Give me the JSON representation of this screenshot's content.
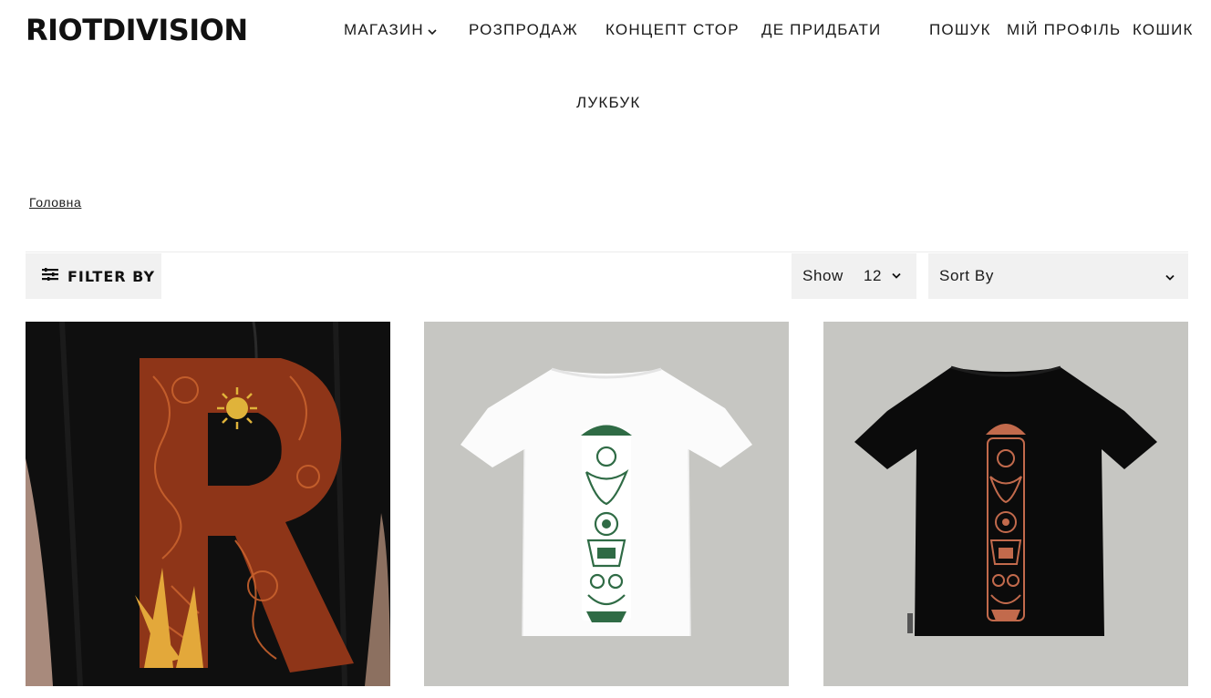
{
  "header": {
    "logo": "RIOTDIVISION",
    "nav": [
      {
        "label": "МАГАЗИН",
        "has_dropdown": true
      },
      {
        "label": "РОЗПРОДАЖ"
      },
      {
        "label": "КОНЦЕПТ СТОР"
      },
      {
        "label": "ДЕ ПРИДБАТИ"
      },
      {
        "label": "ЛУКБУК"
      }
    ],
    "utility": {
      "search": "ПОШУК",
      "profile": "МІЙ ПРОФІЛЬ",
      "cart": "КОШИК"
    }
  },
  "breadcrumb": {
    "home": "Головна"
  },
  "toolbar": {
    "filter_label": "FILTER BY",
    "show_label": "Show",
    "show_value": "12",
    "sort_label": "Sort By"
  },
  "products": [
    {
      "image": "black t-shirt with large orange ornamental R print, worn by model"
    },
    {
      "image": "white t-shirt with green vertical ornamental print on back"
    },
    {
      "image": "black t-shirt with orange vertical ornamental print on back"
    }
  ],
  "colors": {
    "text": "#1a1a1a",
    "toolbar_bg": "#f1f1f1",
    "product_bg": "#c6c6c2",
    "print_orange": "#b5532a",
    "print_green": "#2f6b45"
  },
  "icons": {
    "filter": "filter-lines-icon",
    "chevron": "chevron-down-icon"
  }
}
